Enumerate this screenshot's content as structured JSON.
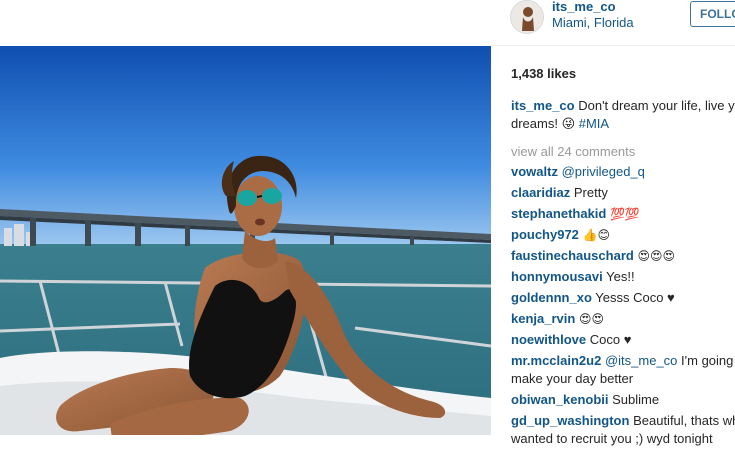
{
  "post": {
    "username": "its_me_co",
    "location": "Miami, Florida",
    "follow_label": "FOLLOW",
    "likes": "1,438 likes"
  },
  "caption": {
    "user": "its_me_co",
    "text": "Don't dream your life, live your dreams! 😜",
    "hashtag": "#MIA"
  },
  "view_all_label": "view all 24 comments",
  "comments": [
    {
      "user": "vowaltz",
      "mention": "@privileged_q",
      "text": ""
    },
    {
      "user": "claaridiaz",
      "mention": "",
      "text": "Pretty"
    },
    {
      "user": "stephanethakid",
      "mention": "",
      "text": "💯💯"
    },
    {
      "user": "pouchy972",
      "mention": "",
      "text": "👍😊"
    },
    {
      "user": "faustinechauschard",
      "mention": "",
      "text": "😍😍😍"
    },
    {
      "user": "honnymousavi",
      "mention": "",
      "text": "Yes!!"
    },
    {
      "user": "goldennn_xo",
      "mention": "",
      "text": "Yesss Coco ♥"
    },
    {
      "user": "kenja_rvin",
      "mention": "",
      "text": "😍😍"
    },
    {
      "user": "noewithlove",
      "mention": "",
      "text": "Coco ♥"
    },
    {
      "user": "mr.mcclain2u2",
      "mention": "@its_me_co",
      "text": "I'm going to make your day better"
    },
    {
      "user": "obiwan_kenobii",
      "mention": "",
      "text": "Sublime"
    },
    {
      "user": "gd_up_washington",
      "mention": "",
      "text": "Beautiful, thats why I wanted to recruit you ;) wyd tonight"
    }
  ]
}
